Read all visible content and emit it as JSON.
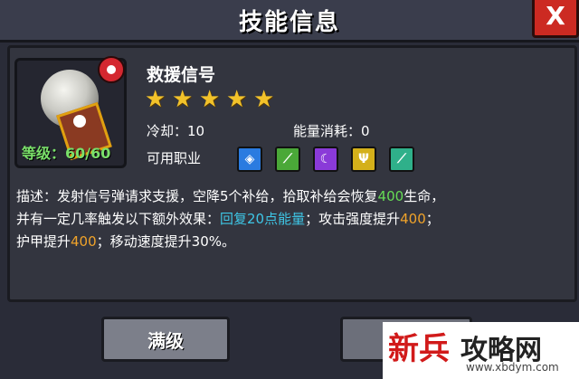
{
  "window": {
    "title": "技能信息",
    "close_label": "X"
  },
  "skill": {
    "name": "救援信号",
    "stars": 5,
    "star_glyph": "★",
    "level_text": "等级：60/60",
    "cooldown_label": "冷却：",
    "cooldown_value": "10",
    "energy_label": "能量消耗：",
    "energy_value": "0",
    "jobs_label": "可用职业",
    "jobs": [
      {
        "name": "shield-job-icon",
        "color": "#2a7be0"
      },
      {
        "name": "sword-job-icon",
        "color": "#4aa838"
      },
      {
        "name": "moon-job-icon",
        "color": "#8a3ad8"
      },
      {
        "name": "trident-job-icon",
        "color": "#d4b01a"
      },
      {
        "name": "blade-job-icon",
        "color": "#2fb08a"
      }
    ]
  },
  "description": {
    "line1_a": "描述：发射信号弹请求支援，空降5个补给，拾取补给会恢复",
    "line1_hl": "400",
    "line1_b": "生命，",
    "line2_a": "并有一定几率触发以下额外效果：",
    "line2_hl1": "回复20点能量",
    "line2_b": "；攻击强度提升",
    "line2_hl2": "400",
    "line2_c": "；",
    "line3_a": "护甲提升",
    "line3_hl": "400",
    "line3_b": "；移动速度提升30%。"
  },
  "buttons": {
    "max_label": "满级",
    "upgrade_label": ""
  },
  "watermark": {
    "logo_new": "新兵",
    "logo_text": "攻略网",
    "url": "www.xbdym.com"
  },
  "colors": {
    "accent_green": "#66dd55",
    "accent_cyan": "#3ec6e6",
    "accent_orange": "#f0a32a",
    "star_gold": "#f2c22a",
    "close_red": "#cc2a22"
  }
}
